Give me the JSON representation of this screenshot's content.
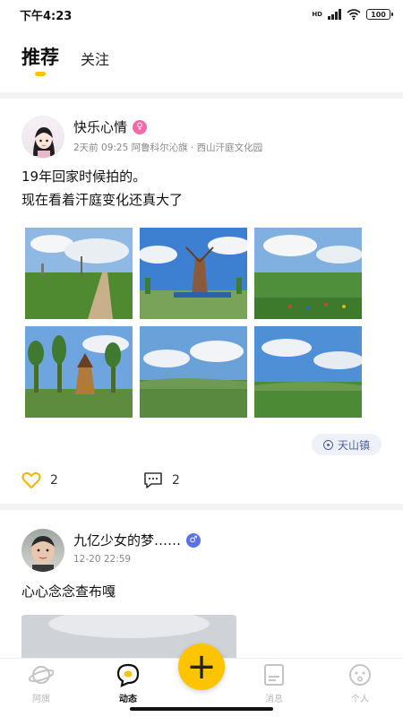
{
  "status_bar": {
    "time": "下午4:23",
    "network": "HD",
    "battery": "100"
  },
  "tabs": {
    "recommend": "推荐",
    "follow": "关注"
  },
  "posts": [
    {
      "username": "快乐心情",
      "gender": "female",
      "gender_symbol": "♀",
      "meta": "2天前 09:25 阿鲁科尔沁旗 · 西山汗庭文化园",
      "text_line1": "19年回家时候拍的。",
      "text_line2": "现在看着汗庭变化还真大了",
      "location": "天山镇",
      "likes": "2",
      "comments": "2"
    },
    {
      "username": "九亿少女的梦……",
      "gender": "male",
      "gender_symbol": "♂",
      "meta": "12-20 22:59",
      "text": "心心念念查布嘎"
    }
  ],
  "nav": {
    "items": [
      {
        "label": "阿旗",
        "icon": "planet-icon"
      },
      {
        "label": "动态",
        "icon": "chat-bubble-icon"
      },
      {
        "label": "消息",
        "icon": "message-board-icon"
      },
      {
        "label": "个人",
        "icon": "face-icon"
      }
    ],
    "fab_symbol": "+"
  },
  "colors": {
    "accent": "#ffc400",
    "location_text": "#4a5fa3",
    "female_badge": "#f26aa8",
    "male_badge": "#5b6fe6"
  }
}
